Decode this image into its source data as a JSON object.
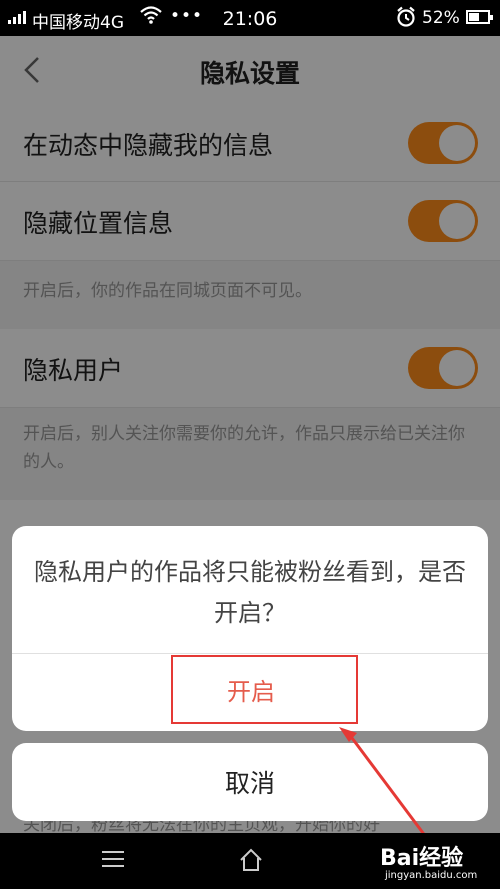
{
  "status_bar": {
    "carrier": "中国移动4G",
    "dots": "•••",
    "time": "21:06",
    "battery": "52%"
  },
  "nav": {
    "title": "隐私设置"
  },
  "settings": [
    {
      "label": "在动态中隐藏我的信息",
      "enabled": true
    },
    {
      "label": "隐藏位置信息",
      "enabled": true
    },
    {
      "label": "隐私用户",
      "enabled": true
    }
  ],
  "notes": [
    "开启后，你的作品在同城页面不可见。",
    "开启后，别人关注你需要你的允许，作品只展示给已关注你的人。"
  ],
  "dialog": {
    "message": "隐私用户的作品将只能被粉丝看到，是否开启？",
    "confirm": "开启",
    "cancel": "取消"
  },
  "partial_hidden_text": "关闭后，粉丝将无法在你的主页观，开始你的好",
  "watermark": {
    "brand": "Bai经验",
    "site": "jingyan.baidu.com"
  },
  "colors": {
    "toggle_on": "#ff8c1a",
    "confirm_text": "#e55c4c",
    "annotation": "#e53935"
  }
}
